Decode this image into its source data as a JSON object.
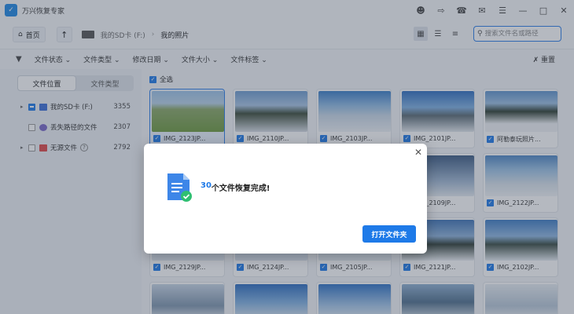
{
  "app": {
    "title": "万兴恢复专家"
  },
  "nav": {
    "home_label": "首页",
    "breadcrumb": [
      "我的SD卡 (F:)",
      "我的照片"
    ],
    "search_placeholder": "搜索文件名或路径"
  },
  "filters": {
    "items": [
      "文件状态 ⌄",
      "文件类型 ⌄",
      "修改日期 ⌄",
      "文件大小 ⌄",
      "文件标签 ⌄"
    ],
    "reset_label": "重置"
  },
  "sidebar": {
    "tabs": [
      "文件位置",
      "文件类型"
    ],
    "tree": [
      {
        "label": "我的SD卡 (F:)",
        "count": "3355"
      },
      {
        "label": "丢失路径的文件",
        "count": "2307"
      },
      {
        "label": "无源文件",
        "count": "2792"
      }
    ]
  },
  "main": {
    "select_all_label": "全选",
    "tiles": [
      "IMG_2123JP...",
      "IMG_2110JP...",
      "IMG_2103JP...",
      "IMG_2101JP...",
      "阿勒泰玩照片...",
      "IMG_2109JP...",
      "IMG_2122JP...",
      "IMG_2129JP...",
      "IMG_2124JP...",
      "IMG_2105JP...",
      "IMG_2121JP...",
      "IMG_2102JP..."
    ]
  },
  "dialog": {
    "count": "30",
    "message": "个文件恢复完成!",
    "button_label": "打开文件夹"
  },
  "colors": {
    "accent": "#1e7ae8"
  }
}
